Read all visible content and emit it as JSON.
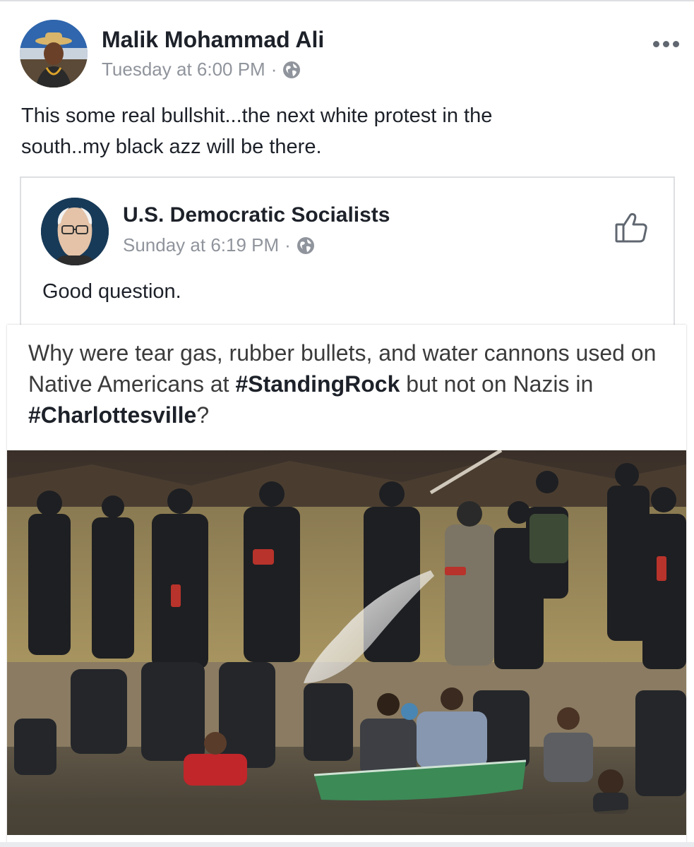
{
  "post": {
    "author": "Malik Mohammad Ali",
    "timestamp": "Tuesday at 6:00 PM",
    "separator": "·",
    "privacy_icon": "globe-icon",
    "menu_icon": "more-options-icon",
    "text_line1": "This some real bullshit...the next white protest in the",
    "text_line2": "south..my black azz will be there."
  },
  "shared_post": {
    "author": "U.S. Democratic Socialists",
    "timestamp": "Sunday at 6:19 PM",
    "separator": "·",
    "privacy_icon": "globe-icon",
    "action_icon": "thumbs-up-icon",
    "text": "Good question."
  },
  "image": {
    "headline_part1": "Why were tear gas, rubber bullets, and water cannons used on Native Americans at ",
    "headline_tag1": "#StandingRock",
    "headline_part2": " but not on Nazis in ",
    "headline_tag2": "#Charlottesville",
    "headline_part3": "?"
  },
  "colors": {
    "text_primary": "#1d2129",
    "text_secondary": "#90949c",
    "border": "#dddfe2"
  }
}
